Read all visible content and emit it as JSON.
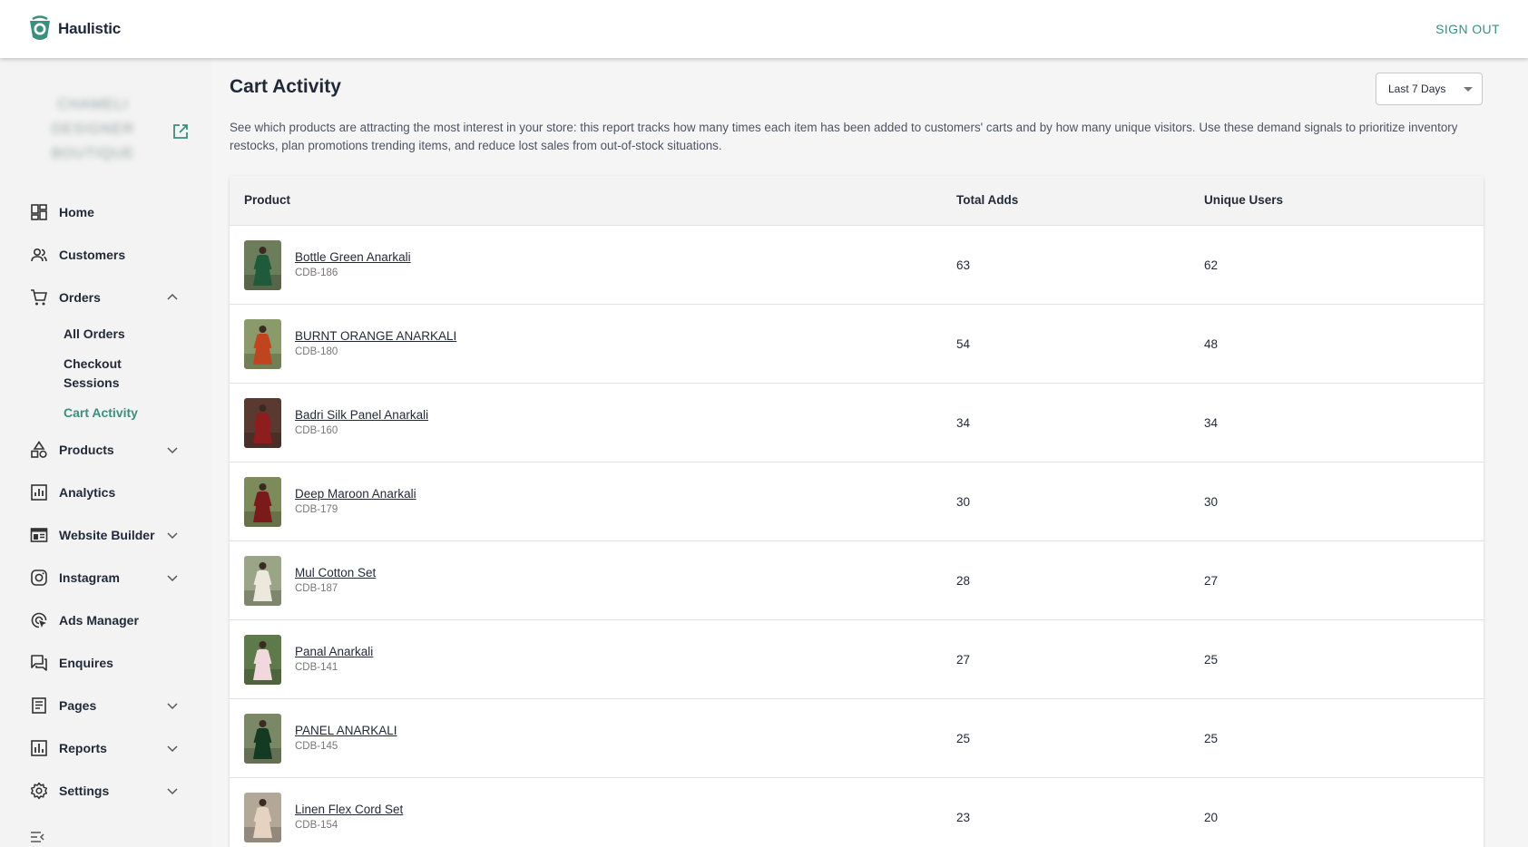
{
  "app": {
    "brand_name": "Haulistic",
    "sign_out_label": "SIGN OUT",
    "accent_color": "#3a8f7e"
  },
  "store": {
    "name": "CHAMELI DESIGNER BOUTIQUE"
  },
  "nav": {
    "items": [
      {
        "label": "Home",
        "icon": "dashboard-icon"
      },
      {
        "label": "Customers",
        "icon": "users-icon"
      },
      {
        "label": "Orders",
        "icon": "cart-icon",
        "expanded": true
      },
      {
        "label": "Products",
        "icon": "shapes-icon",
        "expanded": false
      },
      {
        "label": "Analytics",
        "icon": "analytics-icon"
      },
      {
        "label": "Website Builder",
        "icon": "website-icon",
        "expanded": false
      },
      {
        "label": "Instagram",
        "icon": "instagram-icon",
        "expanded": false
      },
      {
        "label": "Ads Manager",
        "icon": "ads-icon"
      },
      {
        "label": "Enquires",
        "icon": "chat-icon"
      },
      {
        "label": "Pages",
        "icon": "pages-icon",
        "expanded": false
      },
      {
        "label": "Reports",
        "icon": "reports-icon",
        "expanded": false
      },
      {
        "label": "Settings",
        "icon": "gear-icon",
        "expanded": false
      }
    ],
    "orders_sub": [
      {
        "label": "All Orders"
      },
      {
        "label": "Checkout Sessions"
      },
      {
        "label": "Cart Activity",
        "active": true
      }
    ]
  },
  "page": {
    "title": "Cart Activity",
    "date_range": "Last 7 Days",
    "description": "See which products are attracting the most interest in your store: this report tracks how many times each item has been added to customers' carts and by how many unique visitors. Use these demand signals to prioritize inventory restocks, plan promotions trending items, and reduce lost sales from out-of-stock situations."
  },
  "table": {
    "headers": {
      "product": "Product",
      "total_adds": "Total Adds",
      "unique_users": "Unique Users"
    },
    "rows": [
      {
        "name": "Bottle Green Anarkali",
        "sku": "CDB-186",
        "total_adds": "63",
        "unique_users": "62",
        "garment_color": "#1f5a3a",
        "bg_color": "#6b7d5a"
      },
      {
        "name": "BURNT ORANGE ANARKALI",
        "sku": "CDB-180",
        "total_adds": "54",
        "unique_users": "48",
        "garment_color": "#c0451f",
        "bg_color": "#8a9a6a"
      },
      {
        "name": "Badri Silk Panel Anarkali",
        "sku": "CDB-160",
        "total_adds": "34",
        "unique_users": "34",
        "garment_color": "#8e1d1d",
        "bg_color": "#5a3a30"
      },
      {
        "name": "Deep Maroon Anarkali",
        "sku": "CDB-179",
        "total_adds": "30",
        "unique_users": "30",
        "garment_color": "#7a1a1a",
        "bg_color": "#7d8a5a"
      },
      {
        "name": "Mul Cotton Set",
        "sku": "CDB-187",
        "total_adds": "28",
        "unique_users": "27",
        "garment_color": "#ece8dc",
        "bg_color": "#9aa486"
      },
      {
        "name": "Panal Anarkali",
        "sku": "CDB-141",
        "total_adds": "27",
        "unique_users": "25",
        "garment_color": "#f0d8dc",
        "bg_color": "#5f7a4a"
      },
      {
        "name": "PANEL ANARKALI",
        "sku": "CDB-145",
        "total_adds": "25",
        "unique_users": "25",
        "garment_color": "#143a24",
        "bg_color": "#7a8866"
      },
      {
        "name": "Linen Flex Cord Set",
        "sku": "CDB-154",
        "total_adds": "23",
        "unique_users": "20",
        "garment_color": "#e6d2c0",
        "bg_color": "#b3a898"
      }
    ]
  }
}
